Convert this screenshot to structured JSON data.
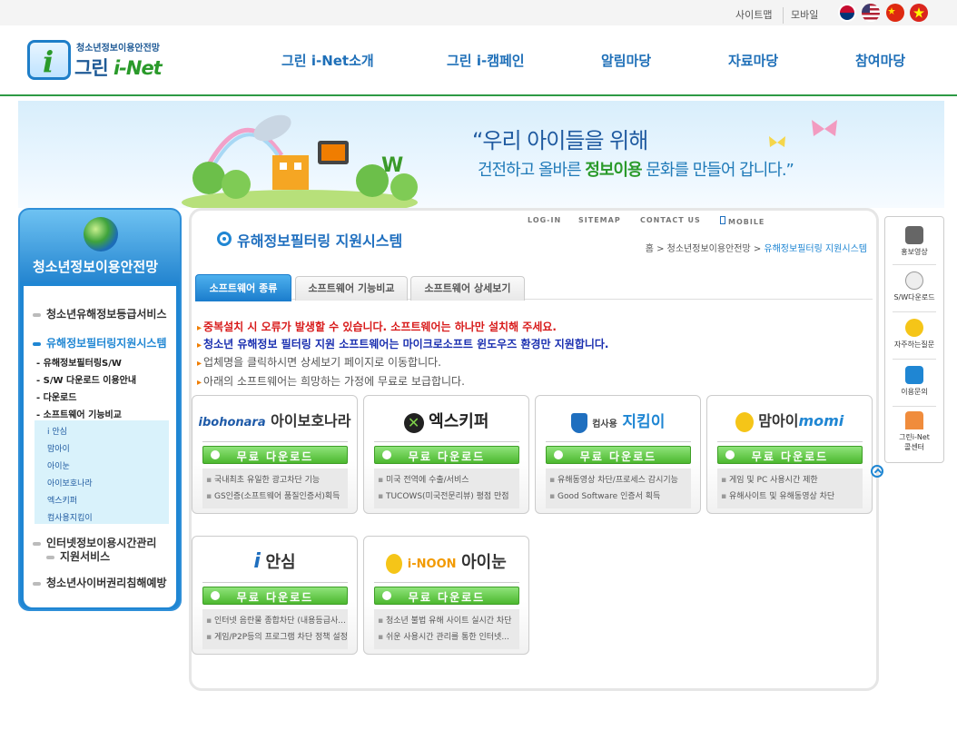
{
  "util": {
    "sitemap": "사이트맵",
    "mobile": "모바일"
  },
  "flags": [
    "korea-flag-icon",
    "usa-flag-icon",
    "china-flag-icon",
    "vietnam-flag-icon"
  ],
  "logo": {
    "sub": "청소년정보이용안전망",
    "main_prefix": "그린 ",
    "main_em": "i-Net"
  },
  "gnb": [
    "그린 i-Net소개",
    "그린 i-캠페인",
    "알림마당",
    "자료마당",
    "참여마당"
  ],
  "banner": {
    "quote1": "“우리 아이들을 위해",
    "quote2_a": "건전하고 올바른 ",
    "quote2_b": "정보이용",
    "quote2_c": " 문화를 만들어 갑니다.”"
  },
  "lnb": {
    "title": "청소년정보이용안전망",
    "cats": [
      "청소년유해정보등급서비스",
      "유해정보필터링지원시스템",
      "인터넷정보이용시간관리",
      "지원서비스",
      "청소년사이버권리침해예방"
    ],
    "subs": [
      "- 유해정보필터링S/W",
      "- S/W 다운로드 이용안내",
      "- 다운로드",
      "- 소프트웨어 기능비교"
    ],
    "leaves": [
      "i 안심",
      "맘아이",
      "아이눈",
      "아이보호나라",
      "엑스키퍼",
      "컴사용지킴이"
    ]
  },
  "content": {
    "top_util": [
      "LOG-IN",
      "SITEMAP",
      "CONTACT US",
      "MOBILE"
    ],
    "title": "유해정보필터링 지원시스템",
    "breadcrumb": {
      "home": "홈",
      "sep": " > ",
      "parent": "청소년정보이용안전망",
      "current": "유해정보필터링 지원시스템"
    },
    "tabs": [
      "소프트웨어 종류",
      "소프트웨어 기능비교",
      "소프트웨어 상세보기"
    ],
    "notices": [
      "중복설치 시 오류가 발생할 수 있습니다. 소프트웨어는 하나만 설치해 주세요.",
      "청소년 유해정보 필터링 지원 소프트웨어는 마이크로소프트 윈도우즈 환경만 지원합니다.",
      "업체명을 클릭하시면 상세보기 페이지로 이동합니다.",
      "아래의 소프트웨어는 희망하는 가정에 무료로 보급합니다."
    ],
    "download_label": "무료 다운로드",
    "cards": [
      {
        "name_a": "ibohonara",
        "name_b": "아이보호나라",
        "features": [
          "국내최초 유일한 광고차단 기능",
          "GS인증(소프트웨어 품질인증서)획득"
        ]
      },
      {
        "name_a": "",
        "name_b": "엑스키퍼",
        "features": [
          "미국 전역에 수출/서비스",
          "TUCOWS(미국전문리뷰) 평점 만점"
        ]
      },
      {
        "name_a": "컴사용",
        "name_b": "지킴이",
        "features": [
          "유해동영상 차단/프로세스 감시기능",
          "Good Software 인증서 획득"
        ]
      },
      {
        "name_a": "맘아이",
        "name_b": "momi",
        "features": [
          "게임 및 PC 사용시간 제한",
          "유해사이트 및 유해동영상 차단"
        ]
      },
      {
        "name_a": "i",
        "name_b": "안심",
        "features": [
          "인터넷 음란물 종합차단 (내용등급사...",
          "게임/P2P등의 프로그램 차단 정책 설정"
        ]
      },
      {
        "name_a": "i-NOON",
        "name_b": "아이눈",
        "features": [
          "청소년 불법 유해 사이트 실시간 차단",
          "쉬운 사용시간 관리를 통한 인터넷..."
        ]
      }
    ]
  },
  "quick": [
    "홍보영상",
    "S/W다운로드",
    "자주하는질문",
    "이용문의",
    "그린i-Net 홀센터"
  ],
  "quick_line2": [
    "그린i-Net",
    "콜센터"
  ],
  "colors": {
    "brand_blue": "#1f86d3",
    "brand_green": "#2a9a2a",
    "notice_red": "#d81b1b",
    "notice_blue": "#1a2fb0"
  }
}
